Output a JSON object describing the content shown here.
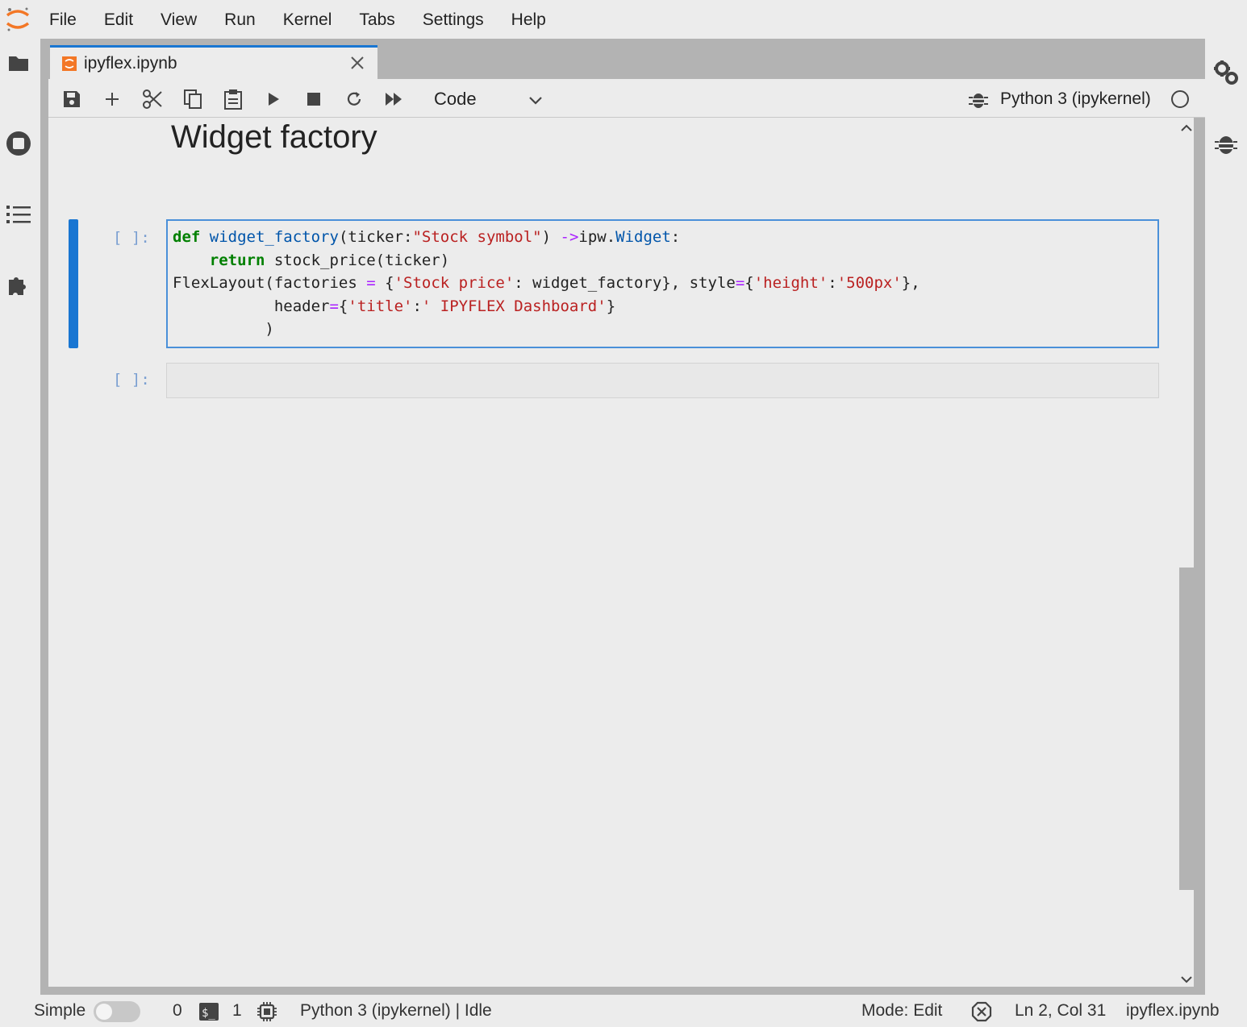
{
  "app": {
    "menu": [
      "File",
      "Edit",
      "View",
      "Run",
      "Kernel",
      "Tabs",
      "Settings",
      "Help"
    ]
  },
  "tab": {
    "label": "ipyflex.ipynb"
  },
  "toolbar": {
    "cell_type": "Code",
    "kernel_name": "Python 3 (ipykernel)"
  },
  "notebook": {
    "heading": "Widget factory",
    "cells": [
      {
        "prompt": "[ ]:"
      },
      {
        "prompt": "[ ]:"
      }
    ]
  },
  "statusbar": {
    "simple_label": "Simple",
    "terminals_count": "0",
    "kernels_count": "1",
    "kernel_status": "Python 3 (ipykernel) | Idle",
    "mode": "Mode: Edit",
    "cursor_position": "Ln 2, Col 31",
    "file_name": "ipyflex.ipynb"
  },
  "colors": {
    "accent": "#1976d2",
    "background": "#ececec",
    "tab_strip": "#b3b3b3"
  }
}
